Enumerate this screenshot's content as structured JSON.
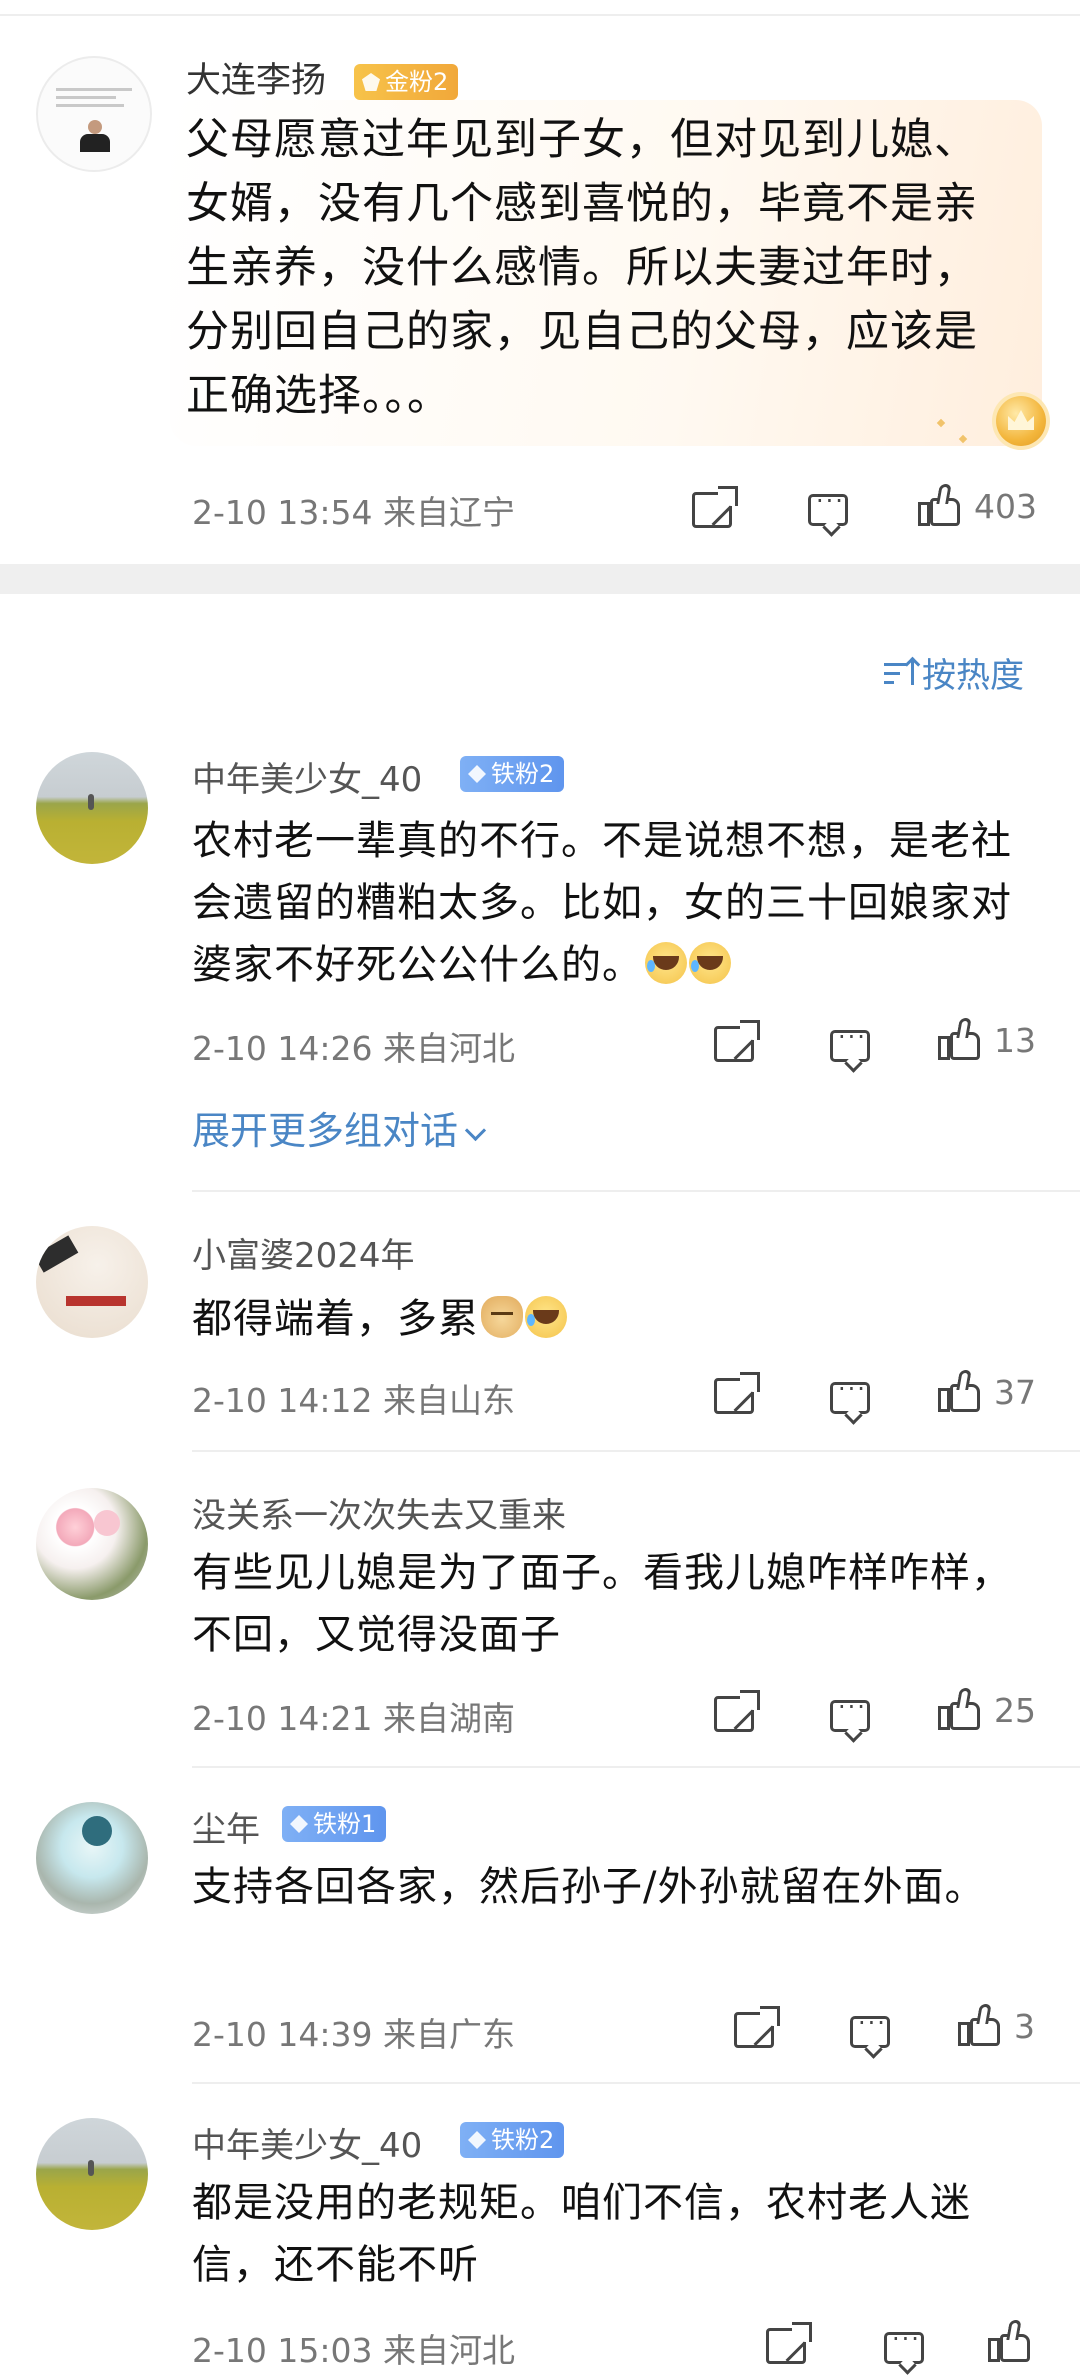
{
  "main_comment": {
    "author": "大连李扬",
    "badge": "金粉2",
    "text": "父母愿意过年见到子女，但对见到儿媳、女婿，没有几个感到喜悦的，毕竟不是亲生亲养，没什么感情。所以夫妻过年时，分别回自己的家，见自己的父母，应该是正确选择。。。",
    "meta": "2-10 13:54 来自辽宁",
    "likes": "403"
  },
  "sort_label": "按热度",
  "expand_label": "展开更多组对话",
  "comments": [
    {
      "author": "中年美少女_40",
      "badge": "铁粉2",
      "text": "农村老一辈真的不行。不是说想不想，是老社会遗留的糟粕太多。比如，女的三十回娘家对婆家不好死公公什么的。",
      "meta": "2-10 14:26 来自河北",
      "likes": "13"
    },
    {
      "author": "小富婆2024年",
      "badge": "",
      "text": "都得端着，多累",
      "meta": "2-10 14:12 来自山东",
      "likes": "37"
    },
    {
      "author": "没关系一次次失去又重来",
      "badge": "",
      "text": "有些见儿媳是为了面子。看我儿媳咋样咋样，不回，又觉得没面子",
      "meta": "2-10 14:21 来自湖南",
      "likes": "25"
    },
    {
      "author": "尘年",
      "badge": "铁粉1",
      "text": "支持各回各家，然后孙子/外孙就留在外面。",
      "meta": "2-10 14:39 来自广东",
      "likes": "3"
    },
    {
      "author": "中年美少女_40",
      "badge": "铁粉2",
      "text": "都是没用的老规矩。咱们不信，农村老人迷信，还不能不听",
      "meta": "2-10 15:03 来自河北",
      "likes": ""
    }
  ],
  "icons": {
    "share": "share-icon",
    "reply": "comment-icon",
    "like": "thumbs-up-icon",
    "sort": "sort-icon",
    "expand": "chevron-down-icon"
  },
  "colors": {
    "link": "#4a86c5",
    "gold_badge": "#f3b03f",
    "iron_badge": "#6b9ff0"
  }
}
